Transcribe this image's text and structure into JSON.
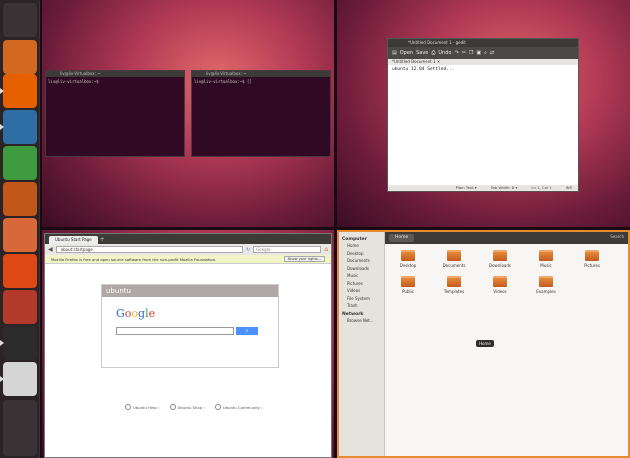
{
  "launcher": {
    "items": [
      {
        "name": "dash-home",
        "color": "#3a3235"
      },
      {
        "name": "home-folder",
        "color": "#d2691e"
      },
      {
        "name": "firefox",
        "color": "#e66000"
      },
      {
        "name": "writer",
        "color": "#2f6ea5"
      },
      {
        "name": "calc",
        "color": "#3e9a3e"
      },
      {
        "name": "impress",
        "color": "#c2571a"
      },
      {
        "name": "software-center",
        "color": "#d8673a"
      },
      {
        "name": "ubuntu-one",
        "color": "#dd4814"
      },
      {
        "name": "system-settings",
        "color": "#b33a2a"
      },
      {
        "name": "terminal",
        "color": "#2b2b2b"
      },
      {
        "name": "gedit",
        "color": "#d5d5d5"
      },
      {
        "name": "workspace-switcher",
        "color": "#3a3235"
      },
      {
        "name": "trash",
        "color": "#3a3235"
      }
    ]
  },
  "terminal1": {
    "title": "liv@liv-Virtualbox: ~",
    "prompt": "liv@liv-virtualbox:~$"
  },
  "terminal2": {
    "title": "liv@liv-Virtualbox: ~",
    "prompt": "liv@liv-virtualbox:~$ []"
  },
  "gedit": {
    "title": "*Untitled Document 1 - gedit",
    "toolbar": {
      "open": "Open",
      "save": "Save",
      "undo": "Undo"
    },
    "tab": "*Untitled Document 1 ×",
    "text": "ubuntu 12.04 Settled...",
    "status": {
      "mode": "Plain Text ▾",
      "tab_width": "Tab Width: 8 ▾",
      "position": "Ln 1, Col 1",
      "ins": "INS"
    }
  },
  "firefox": {
    "tab": "Ubuntu Start Page",
    "url": "about:startpage",
    "search_placeholder": "Google",
    "notice": "Mozilla Firefox is free and open source software from the non-profit Mozilla Foundation.",
    "notice_button": "Know your rights...",
    "page": {
      "brand": "ubuntu",
      "google": [
        "G",
        "o",
        "o",
        "g",
        "l",
        "e"
      ],
      "links": [
        "Ubuntu Help ›",
        "Ubuntu Shop ›",
        "Ubuntu Community ›"
      ]
    }
  },
  "nautilus": {
    "crumb": "Home",
    "search": "Search",
    "sidebar": {
      "computer_heading": "Computer",
      "computer_items": [
        "Home",
        "Desktop",
        "Documents",
        "Downloads",
        "Music",
        "Pictures",
        "Videos",
        "File System",
        "Trash"
      ],
      "network_heading": "Network",
      "network_items": [
        "Browse Net..."
      ]
    },
    "folders": [
      "Desktop",
      "Documents",
      "Downloads",
      "Music",
      "Pictures",
      "Public",
      "Templates",
      "Videos",
      "Examples"
    ],
    "tooltip": "Home"
  }
}
